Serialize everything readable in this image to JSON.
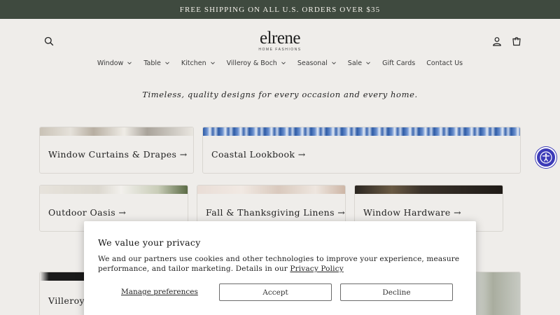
{
  "announcement": "FREE SHIPPING ON ALL U.S. ORDERS OVER $35",
  "logo": {
    "main": "elrene",
    "sub": "HOME FASHIONS"
  },
  "nav": [
    {
      "label": "Window",
      "dropdown": true
    },
    {
      "label": "Table",
      "dropdown": true
    },
    {
      "label": "Kitchen",
      "dropdown": true
    },
    {
      "label": "Villeroy & Boch",
      "dropdown": true
    },
    {
      "label": "Seasonal",
      "dropdown": true
    },
    {
      "label": "Sale",
      "dropdown": true
    },
    {
      "label": "Gift Cards",
      "dropdown": false
    },
    {
      "label": "Contact Us",
      "dropdown": false
    }
  ],
  "tagline": "Timeless, quality designs for every occasion and every home.",
  "collections": [
    "Window Curtains & Drapes →",
    "Coastal Lookbook →",
    "Outdoor Oasis →",
    "Fall & Thanksgiving Linens →",
    "Window Hardware →",
    "Villeroy"
  ],
  "privacy": {
    "title": "We value your privacy",
    "body": "We and our partners use cookies and other technologies to improve your experience, measure performance, and tailor marketing. Details in our",
    "link": "Privacy Policy",
    "manage": "Manage preferences",
    "accept": "Accept",
    "decline": "Decline"
  },
  "colors": {
    "announcement_bg": "#3f4a3f",
    "page_bg": "#efedea",
    "accessibility": "#3c3bb8"
  }
}
